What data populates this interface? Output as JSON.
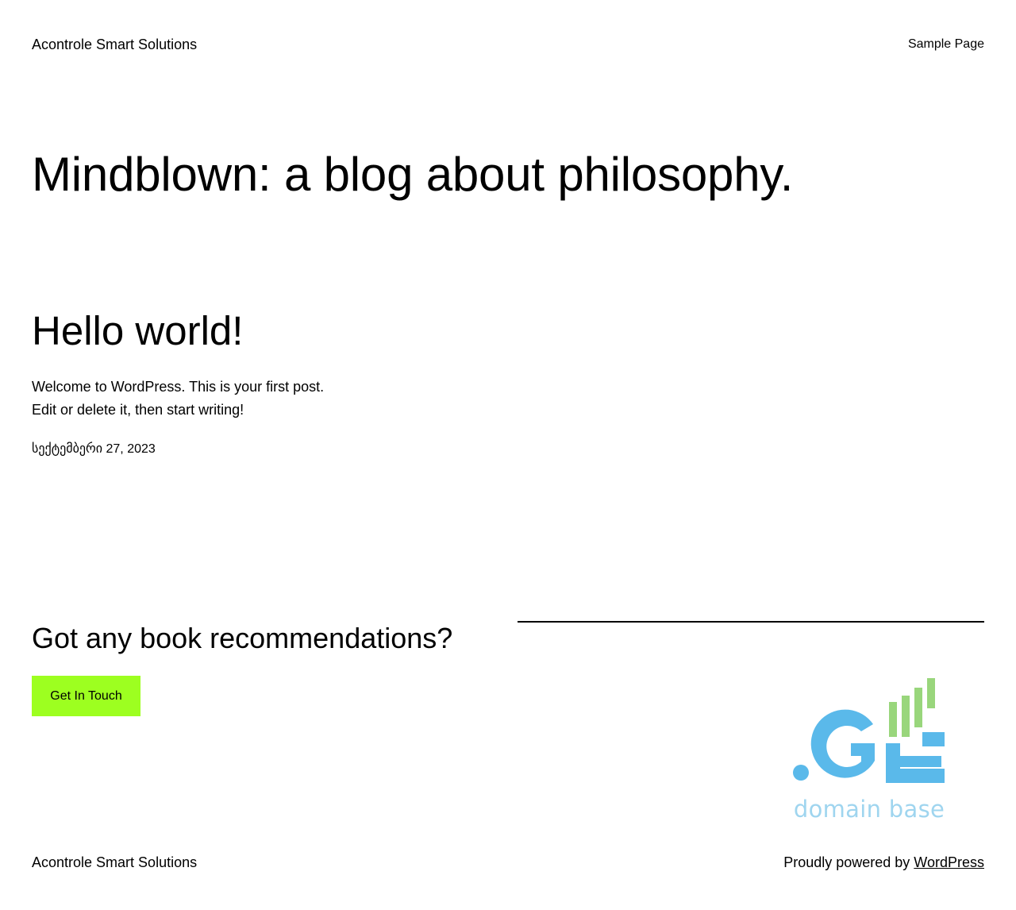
{
  "header": {
    "site_title": "Acontrole Smart Solutions",
    "nav_items": [
      {
        "label": "Sample Page"
      }
    ]
  },
  "tagline": "Mindblown: a blog about philosophy.",
  "post": {
    "title": "Hello world!",
    "excerpt": "Welcome to WordPress. This is your first post. Edit or delete it, then start writing!",
    "date": "სექტემბერი 27, 2023"
  },
  "cta": {
    "heading": "Got any book recommendations?",
    "button_label": "Get In Touch"
  },
  "logo": {
    "mark_text": ".GE",
    "caption": "domain base",
    "colors": {
      "blue": "#5ab9ea",
      "green": "#99d67c",
      "caption": "#9fd5ef"
    }
  },
  "footer": {
    "site_title": "Acontrole Smart Solutions",
    "powered_prefix": "Proudly powered by",
    "powered_link": "WordPress"
  },
  "colors": {
    "accent": "#9dff20",
    "text": "#000000",
    "background": "#ffffff"
  }
}
